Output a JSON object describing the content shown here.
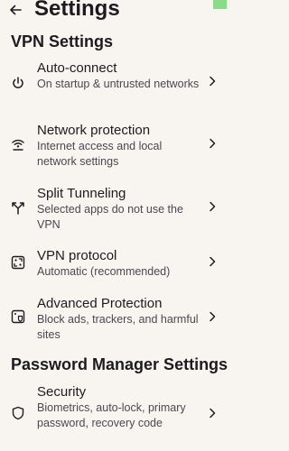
{
  "header": {
    "title": "Settings"
  },
  "vpn_section": {
    "title": "VPN Settings",
    "items": [
      {
        "label": "Auto-connect",
        "description": "On startup & untrusted networks",
        "icon": "power-icon"
      },
      {
        "label": "Network protection",
        "description": "Internet access and local network settings",
        "icon": "wifi-shield-icon"
      },
      {
        "label": "Split Tunneling",
        "description": "Selected apps do not use the VPN",
        "icon": "split-icon"
      },
      {
        "label": "VPN protocol",
        "description": "Automatic (recommended)",
        "icon": "protocol-icon"
      },
      {
        "label": "Advanced Protection",
        "description": "Block ads, trackers, and harmful sites",
        "icon": "advanced-protection-icon"
      }
    ]
  },
  "password_section": {
    "title": "Password Manager Settings",
    "items": [
      {
        "label": "Security",
        "description": "Biometrics, auto-lock, primary password, recovery code",
        "icon": "shield-icon"
      }
    ]
  }
}
